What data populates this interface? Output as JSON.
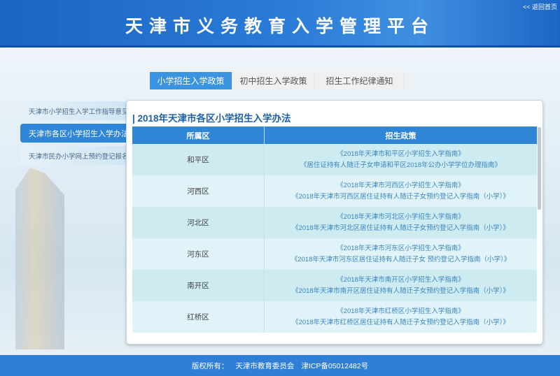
{
  "header": {
    "title": "天津市义务教育入学管理平台",
    "home_link": "<< 返回首页"
  },
  "tabs": [
    "小学招生入学政策",
    "初中招生入学政策",
    "招生工作纪律通知"
  ],
  "sidebar": [
    "天津市小学招生入学工作指导意见",
    "天津市各区小学招生入学办法",
    "天津市民办小学网上预约登记报名"
  ],
  "panel": {
    "title": "| 2018年天津市各区小学招生入学办法",
    "columns": [
      "所属区",
      "招生政策"
    ],
    "rows": [
      {
        "district": "和平区",
        "p1": "《2018年天津市和平区小学招生入学指南》",
        "p2": "《居住证持有人随迁子女申请和平区2018年公办小学学位办理指南》"
      },
      {
        "district": "河西区",
        "p1": "《2018年天津市河西区小学招生入学指南》",
        "p2": "《2018年天津市河西区居住证持有人随迁子女预约登记入学指南（小学）》"
      },
      {
        "district": "河北区",
        "p1": "《2018年天津市河北区小学招生入学指南》",
        "p2": "《2018年天津市河北区居住证持有人随迁子女预约登记入学指南（小学）》"
      },
      {
        "district": "河东区",
        "p1": "《2018年天津市河东区小学招生入学指南》",
        "p2": "《2018年天津市河东区居住证持有人随迁子女 预约登记入学指南（小学）》"
      },
      {
        "district": "南开区",
        "p1": "《2018年天津市南开区小学招生入学指南》",
        "p2": "《2018年天津市南开区居住证持有人随迁子女预约登记入学指南（小学）》"
      },
      {
        "district": "红桥区",
        "p1": "《2018年天津市红桥区小学招生入学指南》",
        "p2": "《2018年天津市红桥区居住证持有人随迁子女预约登记入学指南（小学）》"
      }
    ]
  },
  "footer": {
    "copyright": "版权所有：",
    "org": "天津市教育委员会",
    "icp": "津ICP备05012482号"
  }
}
